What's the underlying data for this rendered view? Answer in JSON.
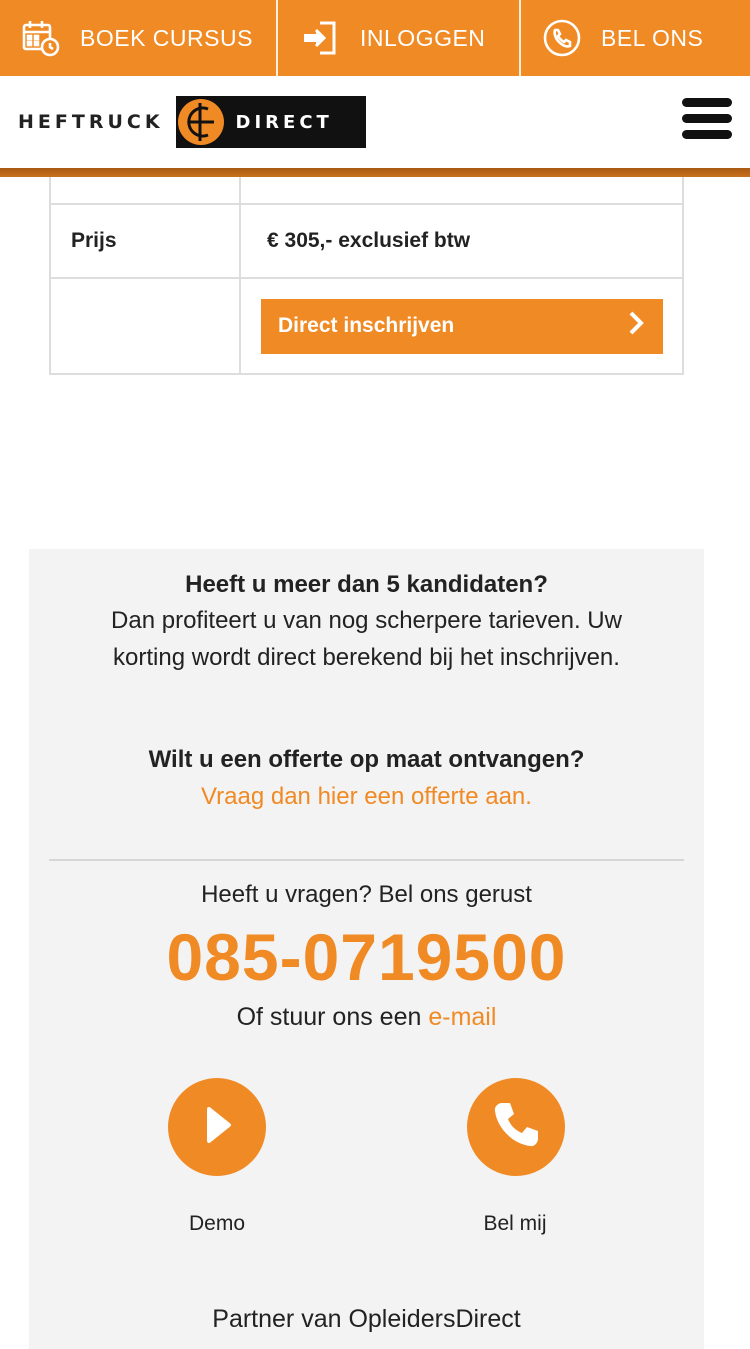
{
  "colors": {
    "accent": "#f08a24",
    "dark": "#111111",
    "panel": "#f3f3f3"
  },
  "topbar": {
    "items": [
      {
        "label": "BOEK CURSUS",
        "icon": "calendar-clock-icon"
      },
      {
        "label": "INLOGGEN",
        "icon": "login-arrow-icon"
      },
      {
        "label": "BEL ONS",
        "icon": "phone-circle-icon"
      }
    ]
  },
  "header": {
    "logo_left": "HEFTRUCK",
    "logo_right": "DIRECT",
    "menu_icon": "hamburger-menu-icon"
  },
  "table": {
    "price_label": "Prijs",
    "price_value": "€ 305,- exclusief btw",
    "cta_label": "Direct inschrijven",
    "cta_icon": "chevron-right-icon"
  },
  "panel": {
    "candidates_title": "Heeft u meer dan 5 kandidaten?",
    "candidates_text_1": "Dan profiteert u van nog scherpere tarieven. Uw",
    "candidates_text_2": "korting wordt direct berekend bij het inschrijven.",
    "quote_title": "Wilt u een offerte op maat ontvangen?",
    "quote_link": "Vraag dan hier een offerte aan.",
    "question": "Heeft u vragen? Bel ons gerust",
    "phone": "085-0719500",
    "mail_prefix": "Of stuur ons een",
    "mail_link": "e-mail",
    "demo_label": "Demo",
    "demo_icon": "play-icon",
    "call_label": "Bel mij",
    "call_icon": "phone-icon",
    "partner": "Partner van OpleidersDirect"
  }
}
